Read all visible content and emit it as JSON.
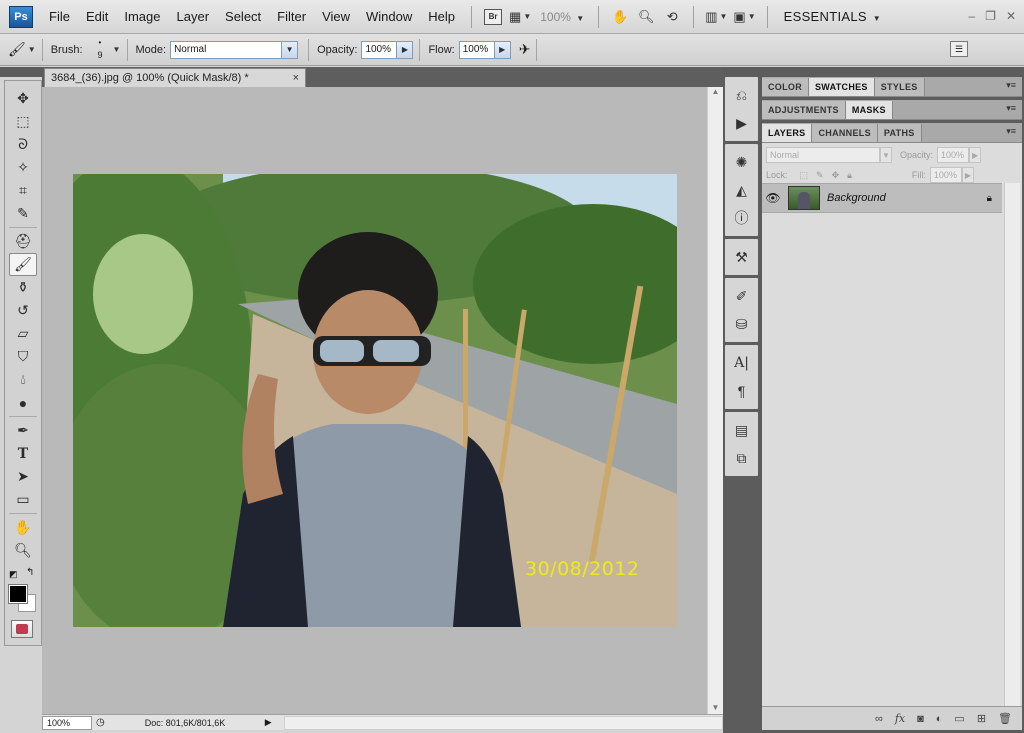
{
  "app": {
    "logo": "Ps",
    "workspace": "ESSENTIALS",
    "zoom": "100%"
  },
  "menu": [
    "File",
    "Edit",
    "Image",
    "Layer",
    "Select",
    "Filter",
    "View",
    "Window",
    "Help"
  ],
  "menubar_icons": [
    "bridge-icon",
    "mini-bridge-icon",
    "hand-icon",
    "zoom-icon",
    "rotate-view-icon",
    "arrange-documents-icon",
    "screen-mode-icon"
  ],
  "options": {
    "brush_label": "Brush:",
    "brush_size": "9",
    "mode_label": "Mode:",
    "mode_value": "Normal",
    "opacity_label": "Opacity:",
    "opacity_value": "100%",
    "flow_label": "Flow:",
    "flow_value": "100%"
  },
  "document": {
    "tab_title": "3684_(36).jpg @ 100% (Quick Mask/8) *",
    "close": "×",
    "photo_date": "30/08/2012",
    "status_zoom": "100%",
    "status_doc": "Doc: 801,6K/801,6K"
  },
  "tools": [
    "move-tool-icon",
    "marquee-tool-icon",
    "lasso-tool-icon",
    "magic-wand-tool-icon",
    "crop-tool-icon",
    "eyedropper-tool-icon",
    "healing-brush-tool-icon",
    "brush-tool-icon",
    "clone-stamp-tool-icon",
    "history-brush-tool-icon",
    "eraser-tool-icon",
    "paint-bucket-tool-icon",
    "blur-tool-icon",
    "dodge-tool-icon",
    "pen-tool-icon",
    "type-tool-icon",
    "path-selection-tool-icon",
    "rectangle-tool-icon",
    "hand-tool-icon",
    "zoom-tool-icon"
  ],
  "colors": {
    "foreground": "#000000",
    "background": "#ffffff",
    "date_stamp": "#ecec1c"
  },
  "panels": {
    "group1": [
      "COLOR",
      "SWATCHES",
      "STYLES"
    ],
    "group1_active": "SWATCHES",
    "group2": [
      "ADJUSTMENTS",
      "MASKS"
    ],
    "group2_active": "MASKS",
    "group3": [
      "LAYERS",
      "CHANNELS",
      "PATHS"
    ],
    "group3_active": "LAYERS",
    "blend_mode": "Normal",
    "opacity_label": "Opacity:",
    "opacity_value": "100%",
    "lock_label": "Lock:",
    "fill_label": "Fill:",
    "fill_value": "100%",
    "layers": [
      {
        "name": "Background",
        "visible": true,
        "locked": true
      }
    ]
  }
}
